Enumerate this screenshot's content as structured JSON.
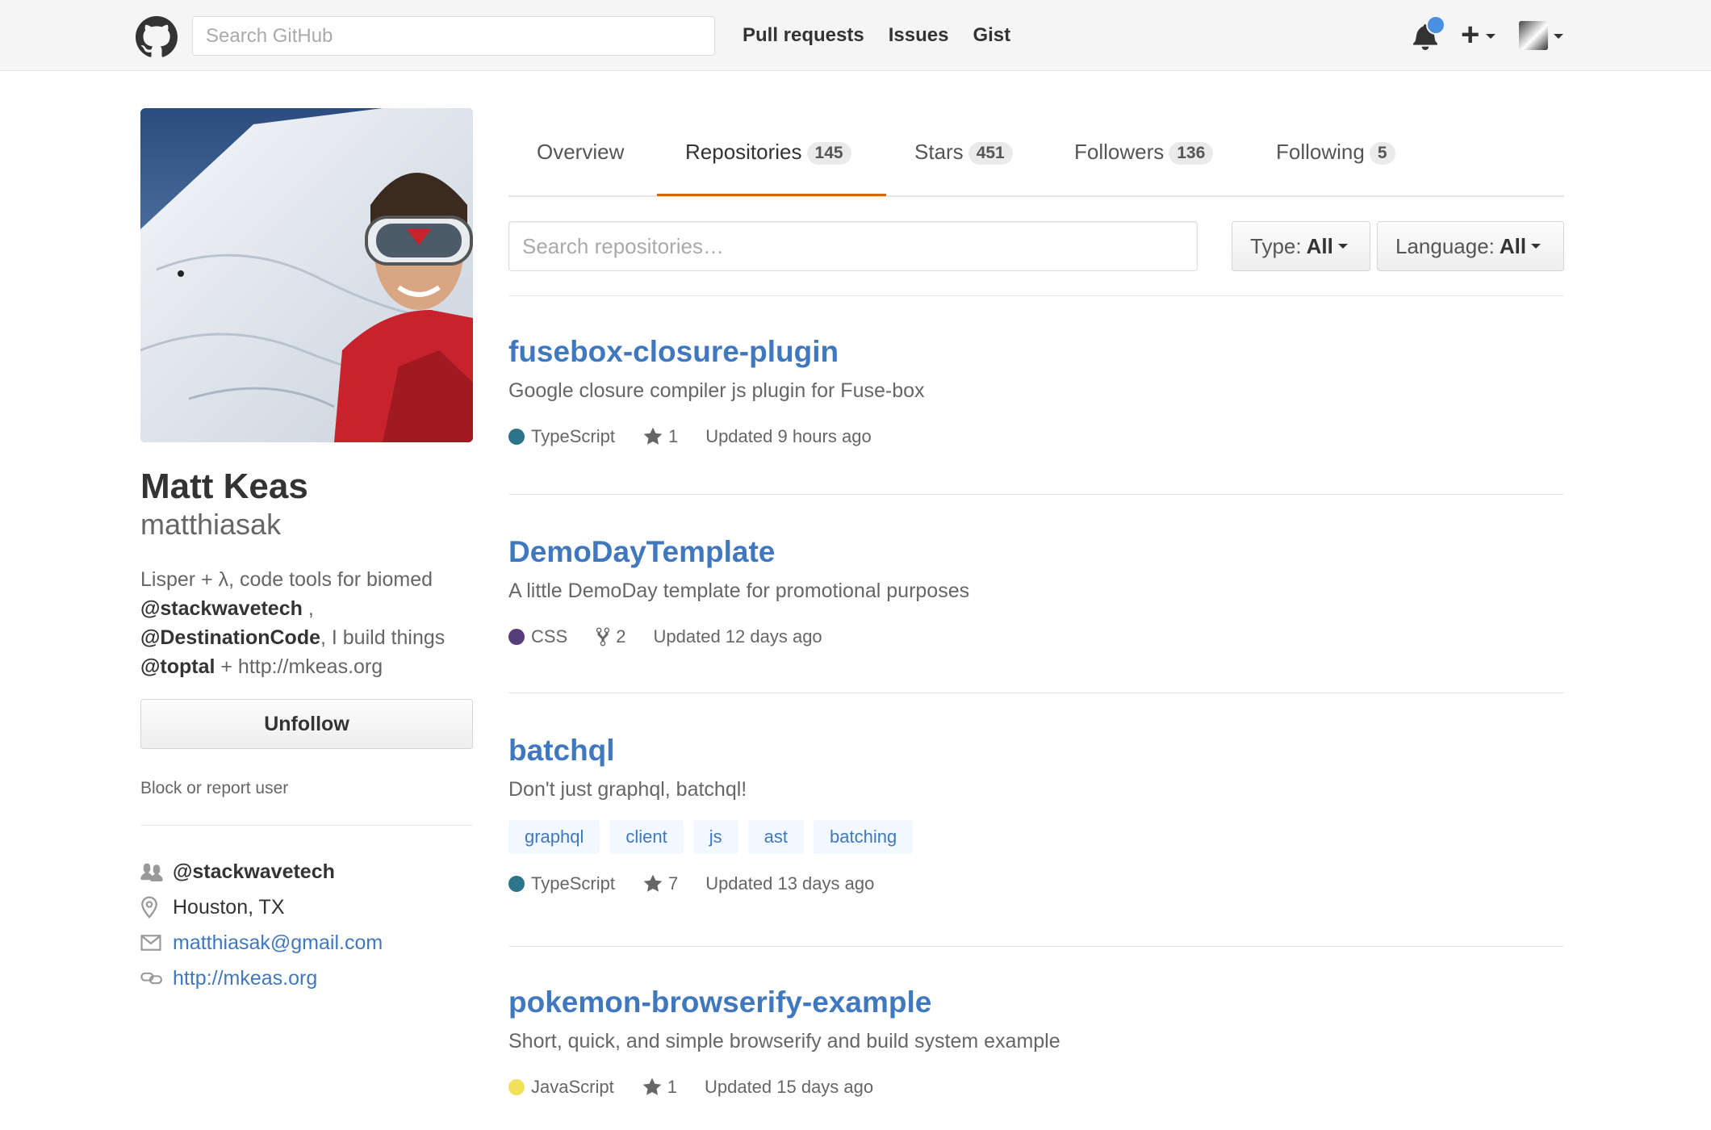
{
  "header": {
    "search_placeholder": "Search GitHub",
    "nav": [
      "Pull requests",
      "Issues",
      "Gist"
    ],
    "plus_label": "+"
  },
  "profile": {
    "fullname": "Matt Keas",
    "username": "matthiasak",
    "bio": {
      "line1": "Lisper + λ, code tools for biomed",
      "org1": "@stackwavetech",
      "sep1": " ,",
      "org2": "@DestinationCode",
      "mid": ", I build things",
      "org3": "@toptal",
      "tail": " + http://mkeas.org"
    },
    "unfollow_label": "Unfollow",
    "block_label": "Block or report user",
    "vcard": {
      "org": "@stackwavetech",
      "location": "Houston, TX",
      "email": "matthiasak@gmail.com",
      "url": "http://mkeas.org"
    }
  },
  "tabs": [
    {
      "label": "Overview",
      "count": ""
    },
    {
      "label": "Repositories",
      "count": "145"
    },
    {
      "label": "Stars",
      "count": "451"
    },
    {
      "label": "Followers",
      "count": "136"
    },
    {
      "label": "Following",
      "count": "5"
    }
  ],
  "filters": {
    "search_placeholder": "Search repositories…",
    "type_label": "Type:",
    "type_value": "All",
    "language_label": "Language:",
    "language_value": "All"
  },
  "repos": [
    {
      "name": "fusebox-closure-plugin",
      "description": "Google closure compiler js plugin for Fuse-box",
      "language": "TypeScript",
      "language_color": "#2b7489",
      "stars": "1",
      "updated": "Updated 9 hours ago"
    },
    {
      "name": "DemoDayTemplate",
      "description": "A little DemoDay template for promotional purposes",
      "language": "CSS",
      "language_color": "#563d7c",
      "forks": "2",
      "updated": "Updated 12 days ago"
    },
    {
      "name": "batchql",
      "description": "Don't just graphql, batchql!",
      "topics": [
        "graphql",
        "client",
        "js",
        "ast",
        "batching"
      ],
      "language": "TypeScript",
      "language_color": "#2b7489",
      "stars": "7",
      "updated": "Updated 13 days ago"
    },
    {
      "name": "pokemon-browserify-example",
      "description": "Short, quick, and simple browserify and build system example",
      "language": "JavaScript",
      "language_color": "#f1e05a",
      "stars": "1",
      "updated": "Updated 15 days ago"
    }
  ],
  "colors": {
    "link": "#4078c0",
    "tab_underline": "#d26911",
    "notification": "#4a90e2"
  }
}
